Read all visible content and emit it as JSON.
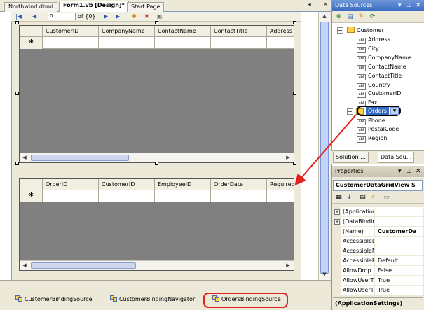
{
  "tabs": [
    {
      "label": "Northwind.dbml",
      "active": false
    },
    {
      "label": "Form1.vb [Design]*",
      "active": true
    },
    {
      "label": "Start Page",
      "active": false
    }
  ],
  "navigator": {
    "position": "0",
    "count": "of {0}"
  },
  "customer_grid": {
    "columns": [
      "CustomerID",
      "CompanyName",
      "ContactName",
      "ContactTitle",
      "Address"
    ],
    "new_row_marker": "*"
  },
  "orders_grid": {
    "columns": [
      "OrderID",
      "CustomerID",
      "EmployeeID",
      "OrderDate",
      "Required"
    ],
    "new_row_marker": "*"
  },
  "tray": {
    "items": [
      {
        "label": "CustomerBindingSource"
      },
      {
        "label": "CustomerBindingNavigator"
      },
      {
        "label": "OrdersBindingSource"
      }
    ]
  },
  "data_sources": {
    "title": "Data Sources",
    "root": "Customer",
    "fields_top": [
      "Address",
      "City",
      "CompanyName",
      "ContactName",
      "ContactTitle",
      "Country",
      "CustomerID",
      "Fax"
    ],
    "orders": "Orders",
    "fields_bottom": [
      "Phone",
      "PostalCode",
      "Region"
    ],
    "field_badge": "abl",
    "bottom_tabs": [
      "Solution ...",
      "Data Sou..."
    ]
  },
  "properties": {
    "title": "Properties",
    "selected_object": "CustomerDataGridView S",
    "rows": [
      {
        "name": "(Application",
        "value": "",
        "expandable": true
      },
      {
        "name": "(DataBindin",
        "value": "",
        "expandable": true
      },
      {
        "name": "(Name)",
        "value": "CustomerDa",
        "expandable": false
      },
      {
        "name": "AccessibleD",
        "value": "",
        "expandable": false
      },
      {
        "name": "AccessibleN",
        "value": "",
        "expandable": false
      },
      {
        "name": "AccessibleR",
        "value": "Default",
        "expandable": false
      },
      {
        "name": "AllowDrop",
        "value": "False",
        "expandable": false
      },
      {
        "name": "AllowUserT",
        "value": "True",
        "expandable": false
      },
      {
        "name": "AllowUserT",
        "value": "True",
        "expandable": false
      }
    ],
    "description": "(ApplicationSettings)"
  },
  "colors": {
    "highlight_red": "#e12020",
    "selection_blue": "#316ac5",
    "grid_background": "#808080"
  }
}
